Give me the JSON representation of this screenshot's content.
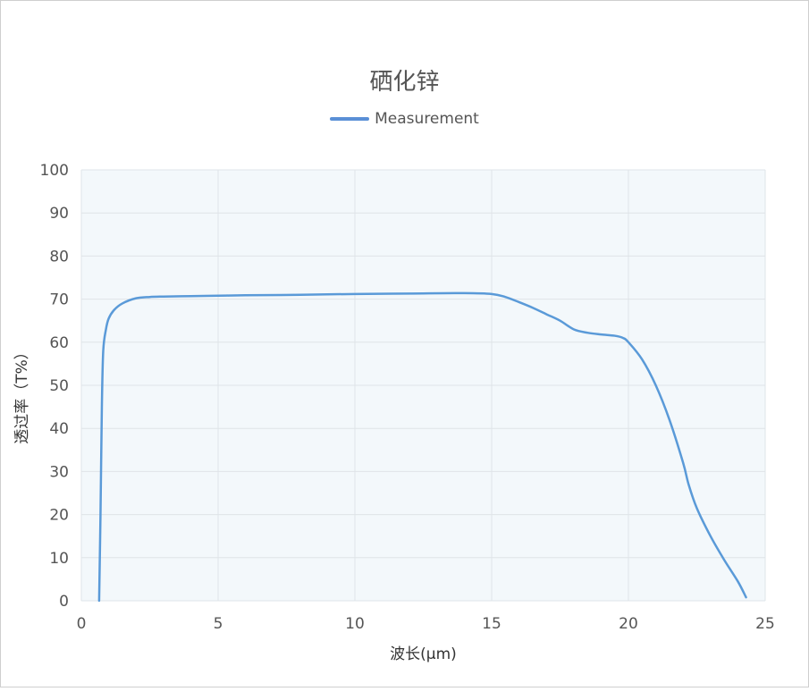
{
  "chart_data": {
    "type": "line",
    "title": "硒化锌",
    "xlabel": "波长(μm)",
    "ylabel": "透过率（T%）",
    "xlim": [
      0,
      25
    ],
    "ylim": [
      0,
      100
    ],
    "xticks": [
      0,
      5,
      10,
      15,
      20,
      25
    ],
    "yticks": [
      0,
      10,
      20,
      30,
      40,
      50,
      60,
      70,
      80,
      90,
      100
    ],
    "grid": true,
    "legend_position": "top-center",
    "plot_background": "#f3f8fb",
    "series": [
      {
        "name": "Measurement",
        "color": "#5a9ad8",
        "x": [
          0.65,
          0.7,
          0.75,
          0.8,
          0.9,
          1.0,
          1.2,
          1.5,
          2.0,
          2.5,
          3,
          4,
          5,
          6,
          8,
          10,
          12,
          14,
          15,
          15.5,
          16,
          16.5,
          17,
          17.5,
          18,
          18.5,
          19,
          19.5,
          19.8,
          20,
          20.5,
          21,
          21.5,
          22,
          22.2,
          22.5,
          23,
          23.5,
          24,
          24.3
        ],
        "y": [
          0,
          20,
          45,
          58,
          63,
          65.5,
          67.5,
          69,
          70.2,
          70.5,
          70.6,
          70.7,
          70.8,
          70.9,
          71.0,
          71.2,
          71.3,
          71.4,
          71.2,
          70.5,
          69.3,
          68.0,
          66.5,
          65.0,
          63.0,
          62.2,
          61.8,
          61.5,
          61.0,
          60.0,
          56.0,
          50.0,
          42.0,
          32.0,
          27.0,
          21.5,
          15.0,
          9.5,
          4.5,
          0.8
        ]
      }
    ]
  }
}
